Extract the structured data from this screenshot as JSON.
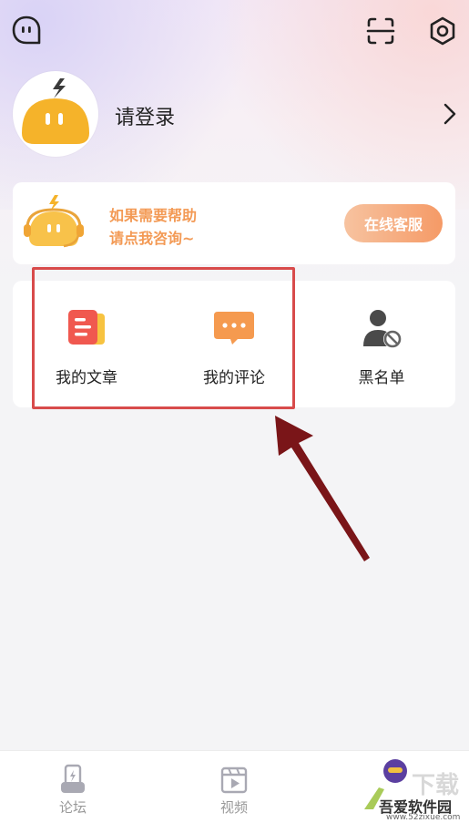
{
  "header": {
    "chat_icon": "chat-bubble-icon",
    "scan_icon": "scan-icon",
    "settings_icon": "settings-icon"
  },
  "profile": {
    "login_label": "请登录"
  },
  "help_card": {
    "line1": "如果需要帮助",
    "line2": "请点我咨询~",
    "service_button": "在线客服"
  },
  "menu": {
    "items": [
      {
        "label": "我的文章",
        "icon": "article-icon"
      },
      {
        "label": "我的评论",
        "icon": "comment-icon"
      },
      {
        "label": "黑名单",
        "icon": "blocked-user-icon"
      }
    ]
  },
  "tabbar": {
    "items": [
      {
        "label": "论坛",
        "icon": "forum-icon"
      },
      {
        "label": "视频",
        "icon": "video-icon"
      }
    ]
  },
  "watermark": {
    "brand": "吾爱软件园",
    "url": "www.52zixue.com"
  },
  "colors": {
    "accent_orange": "#f39a55",
    "highlight_red": "#d84b4b",
    "arrow_dark_red": "#7a1518"
  }
}
